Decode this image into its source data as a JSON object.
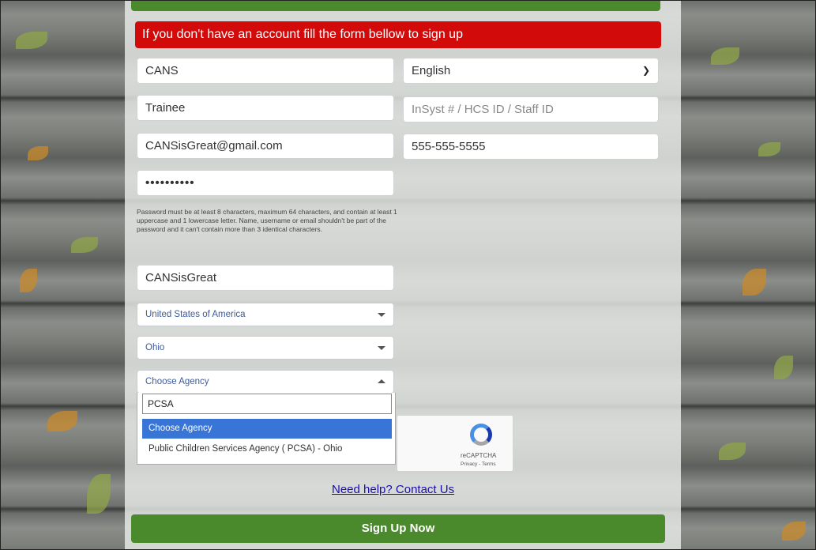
{
  "banner": {
    "text": "If you don't have an account fill the form bellow to sign up"
  },
  "form": {
    "first_name": "CANS",
    "language": "English",
    "last_name": "Trainee",
    "id_placeholder": "InSyst # / HCS ID / Staff ID",
    "email": "CANSisGreat@gmail.com",
    "phone": "555-555-5555",
    "password_mask": "••••••••••",
    "password_hint": "Password must be at least 8 characters, maximum 64 characters, and contain at least 1 uppercase and 1 lowercase letter. Name, username or email shouldn't be part of the password and it can't contain more than 3 identical characters.",
    "username": "CANSisGreat",
    "country": "United States of America",
    "state": "Ohio",
    "agency": "Choose Agency",
    "agency_search": "PCSA",
    "agency_options": [
      "Choose Agency",
      "Public Children Services Agency ( PCSA) - Ohio"
    ]
  },
  "captcha": {
    "label": "reCAPTCHA",
    "links": "Privacy - Terms"
  },
  "help_link": "Need help? Contact Us",
  "submit_label": "Sign Up Now",
  "icons": {
    "chevron": "chevron-down-icon",
    "caret_down": "caret-down-icon",
    "caret_up": "caret-up-icon",
    "recaptcha": "recaptcha-icon"
  },
  "colors": {
    "banner": "#d20a0a",
    "primary": "#4a8a2c",
    "highlight": "#3875d7",
    "link": "#1a0dab"
  }
}
